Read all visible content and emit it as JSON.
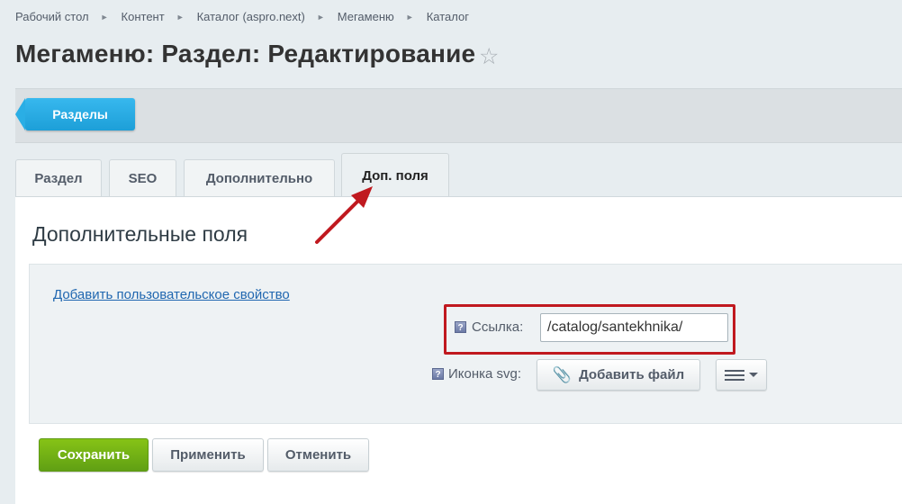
{
  "breadcrumb": [
    "Рабочий стол",
    "Контент",
    "Каталог (aspro.next)",
    "Мегаменю",
    "Каталог"
  ],
  "page_title": "Мегаменю: Раздел: Редактирование",
  "toolbar": {
    "sections_label": "Разделы"
  },
  "tabs": [
    {
      "label": "Раздел",
      "active": false
    },
    {
      "label": "SEO",
      "active": false
    },
    {
      "label": "Дополнительно",
      "active": false
    },
    {
      "label": "Доп. поля",
      "active": true
    }
  ],
  "panel": {
    "title": "Дополнительные поля",
    "add_property_link": "Добавить пользовательское свойство",
    "link_label": "Ссылка:",
    "link_value": "/catalog/santekhnika/",
    "icon_label": "Иконка svg:",
    "add_file_label": "Добавить файл"
  },
  "buttons": {
    "save": "Сохранить",
    "apply": "Применить",
    "cancel": "Отменить"
  },
  "colors": {
    "accent_blue": "#1d9fd8",
    "save_green": "#6aaa14",
    "annotation_red": "#c0191f"
  },
  "icons": {
    "star": "star-icon",
    "help": "help-icon",
    "clip": "paperclip-icon",
    "menu": "menu-icon"
  }
}
